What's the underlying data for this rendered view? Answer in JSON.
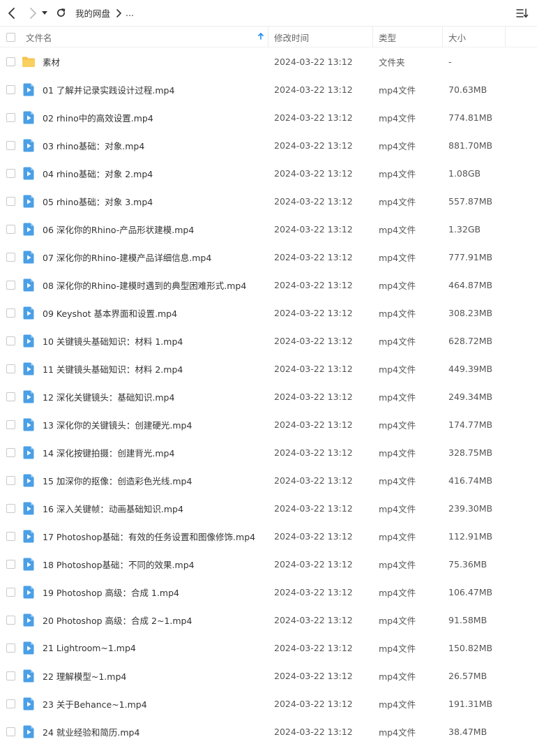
{
  "breadcrumb": {
    "root": "我的网盘",
    "more": "..."
  },
  "columns": {
    "name": "文件名",
    "time": "修改时间",
    "type": "类型",
    "size": "大小"
  },
  "colors": {
    "accent": "#1e8cf0",
    "folder": "#f6c24e",
    "video": "#4a9fe6"
  },
  "files": [
    {
      "icon": "folder-icon",
      "name": "素材",
      "time": "2024-03-22 13:12",
      "type": "文件夹",
      "size": "-"
    },
    {
      "icon": "video-file-icon",
      "name": "01 了解并记录实践设计过程.mp4",
      "time": "2024-03-22 13:12",
      "type": "mp4文件",
      "size": "70.63MB"
    },
    {
      "icon": "video-file-icon",
      "name": "02 rhino中的高效设置.mp4",
      "time": "2024-03-22 13:12",
      "type": "mp4文件",
      "size": "774.81MB"
    },
    {
      "icon": "video-file-icon",
      "name": "03 rhino基础：对象.mp4",
      "time": "2024-03-22 13:12",
      "type": "mp4文件",
      "size": "881.70MB"
    },
    {
      "icon": "video-file-icon",
      "name": "04 rhino基础：对象 2.mp4",
      "time": "2024-03-22 13:12",
      "type": "mp4文件",
      "size": "1.08GB"
    },
    {
      "icon": "video-file-icon",
      "name": "05 rhino基础：对象 3.mp4",
      "time": "2024-03-22 13:12",
      "type": "mp4文件",
      "size": "557.87MB"
    },
    {
      "icon": "video-file-icon",
      "name": "06 深化你的Rhino-产品形状建模.mp4",
      "time": "2024-03-22 13:12",
      "type": "mp4文件",
      "size": "1.32GB"
    },
    {
      "icon": "video-file-icon",
      "name": "07 深化你的Rhino-建模产品详细信息.mp4",
      "time": "2024-03-22 13:12",
      "type": "mp4文件",
      "size": "777.91MB"
    },
    {
      "icon": "video-file-icon",
      "name": "08 深化你的Rhino-建模时遇到的典型困难形式.mp4",
      "time": "2024-03-22 13:12",
      "type": "mp4文件",
      "size": "464.87MB"
    },
    {
      "icon": "video-file-icon",
      "name": "09 Keyshot 基本界面和设置.mp4",
      "time": "2024-03-22 13:12",
      "type": "mp4文件",
      "size": "308.23MB"
    },
    {
      "icon": "video-file-icon",
      "name": "10 关键镜头基础知识：材料 1.mp4",
      "time": "2024-03-22 13:12",
      "type": "mp4文件",
      "size": "628.72MB"
    },
    {
      "icon": "video-file-icon",
      "name": "11 关键镜头基础知识：材料 2.mp4",
      "time": "2024-03-22 13:12",
      "type": "mp4文件",
      "size": "449.39MB"
    },
    {
      "icon": "video-file-icon",
      "name": "12 深化关键镜头：基础知识.mp4",
      "time": "2024-03-22 13:12",
      "type": "mp4文件",
      "size": "249.34MB"
    },
    {
      "icon": "video-file-icon",
      "name": "13 深化你的关键镜头：创建硬光.mp4",
      "time": "2024-03-22 13:12",
      "type": "mp4文件",
      "size": "174.77MB"
    },
    {
      "icon": "video-file-icon",
      "name": "14 深化按键拍摄：创建背光.mp4",
      "time": "2024-03-22 13:12",
      "type": "mp4文件",
      "size": "328.75MB"
    },
    {
      "icon": "video-file-icon",
      "name": "15 加深你的抠像：创造彩色光线.mp4",
      "time": "2024-03-22 13:12",
      "type": "mp4文件",
      "size": "416.74MB"
    },
    {
      "icon": "video-file-icon",
      "name": "16 深入关键帧：动画基础知识.mp4",
      "time": "2024-03-22 13:12",
      "type": "mp4文件",
      "size": "239.30MB"
    },
    {
      "icon": "video-file-icon",
      "name": "17 Photoshop基础：有效的任务设置和图像修饰.mp4",
      "time": "2024-03-22 13:12",
      "type": "mp4文件",
      "size": "112.91MB"
    },
    {
      "icon": "video-file-icon",
      "name": "18 Photoshop基础：不同的效果.mp4",
      "time": "2024-03-22 13:12",
      "type": "mp4文件",
      "size": "75.36MB"
    },
    {
      "icon": "video-file-icon",
      "name": "19 Photoshop 高级：合成 1.mp4",
      "time": "2024-03-22 13:12",
      "type": "mp4文件",
      "size": "106.47MB"
    },
    {
      "icon": "video-file-icon",
      "name": "20 Photoshop 高级：合成 2~1.mp4",
      "time": "2024-03-22 13:12",
      "type": "mp4文件",
      "size": "91.58MB"
    },
    {
      "icon": "video-file-icon",
      "name": "21 Lightroom~1.mp4",
      "time": "2024-03-22 13:12",
      "type": "mp4文件",
      "size": "150.82MB"
    },
    {
      "icon": "video-file-icon",
      "name": "22 理解模型~1.mp4",
      "time": "2024-03-22 13:12",
      "type": "mp4文件",
      "size": "26.57MB"
    },
    {
      "icon": "video-file-icon",
      "name": "23 关于Behance~1.mp4",
      "time": "2024-03-22 13:12",
      "type": "mp4文件",
      "size": "191.31MB"
    },
    {
      "icon": "video-file-icon",
      "name": "24 就业经验和简历.mp4",
      "time": "2024-03-22 13:12",
      "type": "mp4文件",
      "size": "38.47MB"
    }
  ]
}
